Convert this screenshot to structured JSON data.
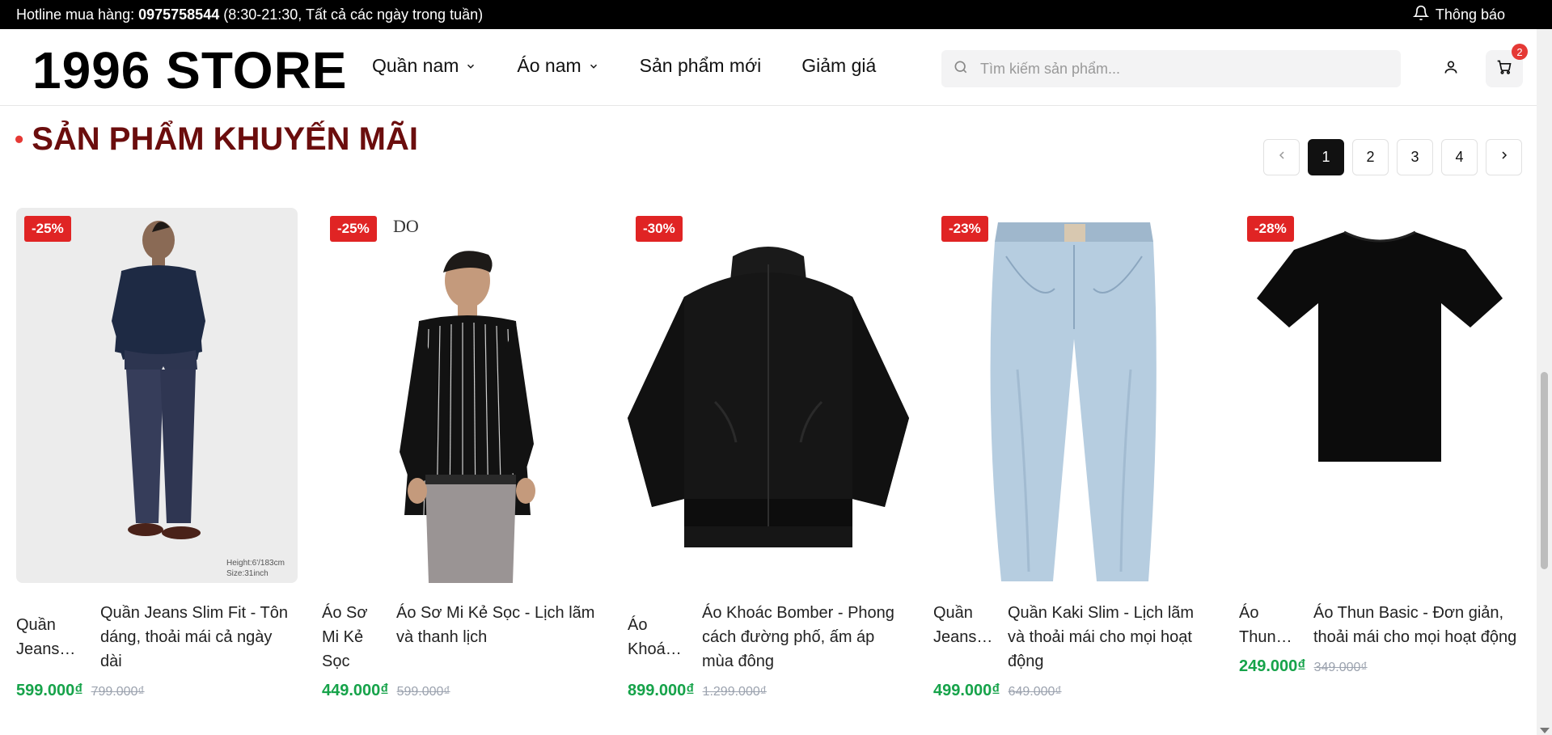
{
  "topbar": {
    "hotline_label": "Hotline mua hàng:",
    "hotline_number": "0975758544",
    "hotline_hours": "(8:30-21:30, Tất cả các ngày trong tuần)",
    "notification_label": "Thông báo"
  },
  "header": {
    "logo": "1996 STORE",
    "nav": [
      {
        "label": "Quần nam",
        "has_dropdown": true
      },
      {
        "label": "Áo nam",
        "has_dropdown": true
      },
      {
        "label": "Sản phẩm mới",
        "has_dropdown": false
      },
      {
        "label": "Giảm giá",
        "has_dropdown": false
      }
    ],
    "search_placeholder": "Tìm kiếm sản phẩm...",
    "cart_count": "2"
  },
  "section": {
    "title": "SẢN PHẨM KHUYẾN MÃI"
  },
  "pagination": {
    "pages": [
      "1",
      "2",
      "3",
      "4"
    ],
    "current": "1"
  },
  "products": [
    {
      "discount": "-25%",
      "short_name": "Quần Jeans…",
      "name": "Quần Jeans Slim Fit - Tôn dáng, thoải mái cả ngày dài",
      "price": "599.000₫",
      "old_price": "799.000₫",
      "image": "man-in-navy-polo-and-jeans",
      "image_caption": "Height:6'/183cm Size:31inch"
    },
    {
      "discount": "-25%",
      "short_name": "Áo Sơ Mi Kẻ Sọc",
      "name": "Áo Sơ Mi Kẻ Sọc - Lịch lãm và thanh lịch",
      "price": "449.000₫",
      "old_price": "599.000₫",
      "image": "man-in-striped-black-shirt"
    },
    {
      "discount": "-30%",
      "short_name": "Áo Khoá…",
      "name": "Áo Khoác Bomber - Phong cách đường phố, ấm áp mùa đông",
      "price": "899.000₫",
      "old_price": "1.299.000₫",
      "image": "black-bomber-jacket"
    },
    {
      "discount": "-23%",
      "short_name": "Quần Jeans…",
      "name": "Quần Kaki Slim - Lịch lãm và thoải mái cho mọi hoạt động",
      "price": "499.000₫",
      "old_price": "649.000₫",
      "image": "light-blue-jeans"
    },
    {
      "discount": "-28%",
      "short_name": "Áo Thun…",
      "name": "Áo Thun Basic - Đơn giản, thoải mái cho mọi hoạt động",
      "price": "249.000₫",
      "old_price": "349.000₫",
      "image": "black-tshirt"
    }
  ]
}
